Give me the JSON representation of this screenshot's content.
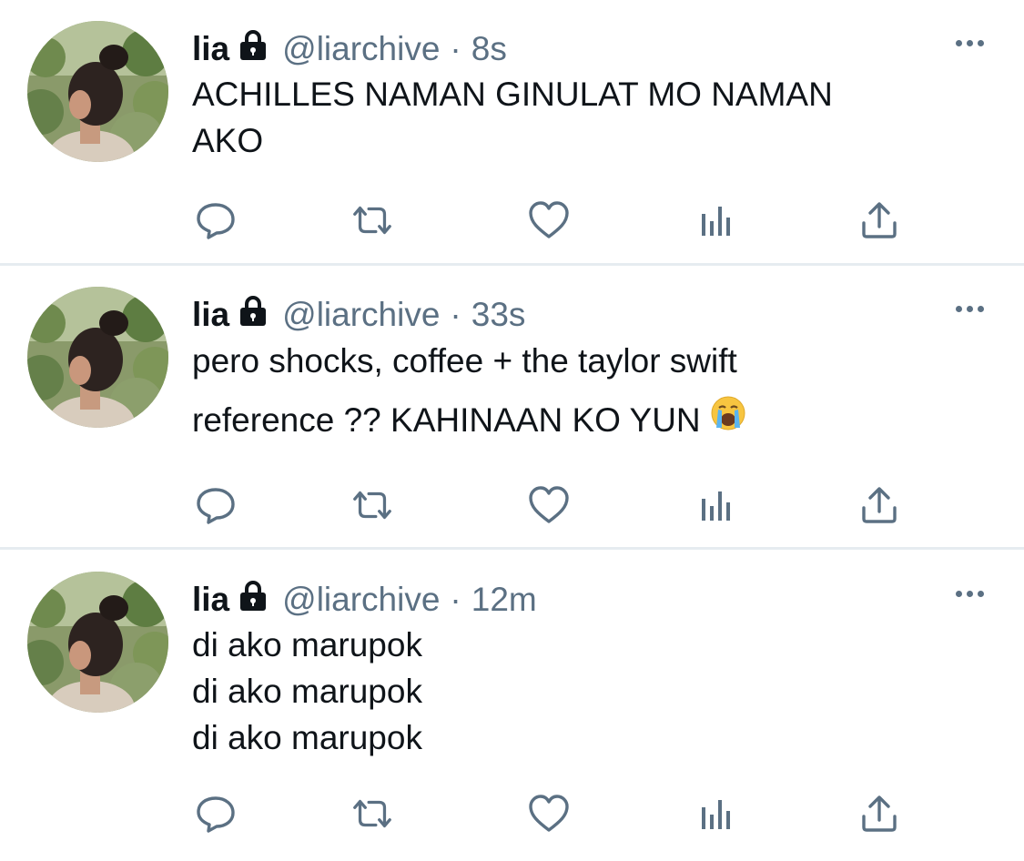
{
  "colors": {
    "text": "#0f1419",
    "secondary": "#5b7083",
    "divider": "#e6ecf0",
    "icon": "#5b7083"
  },
  "tweets": [
    {
      "name": "lia",
      "handle": "@liarchive",
      "separator": "·",
      "time": "8s",
      "lines": [
        "ACHILLES NAMAN GINULAT MO NAMAN",
        "AKO"
      ],
      "icons": [
        "lock-icon",
        "more-icon",
        "reply-icon",
        "retweet-icon",
        "like-icon",
        "analytics-icon",
        "share-icon"
      ]
    },
    {
      "name": "lia",
      "handle": "@liarchive",
      "separator": "·",
      "time": "33s",
      "lines": [
        "pero shocks, coffee + the taylor swift",
        "reference ?? KAHINAAN KO YUN"
      ],
      "emoji": "loudly-crying-face-emoji",
      "icons": [
        "lock-icon",
        "more-icon",
        "reply-icon",
        "retweet-icon",
        "like-icon",
        "analytics-icon",
        "share-icon"
      ]
    },
    {
      "name": "lia",
      "handle": "@liarchive",
      "separator": "·",
      "time": "12m",
      "lines": [
        "di ako marupok",
        "di ako marupok",
        "di ako marupok"
      ],
      "icons": [
        "lock-icon",
        "more-icon",
        "reply-icon",
        "retweet-icon",
        "like-icon",
        "analytics-icon",
        "share-icon"
      ]
    }
  ]
}
